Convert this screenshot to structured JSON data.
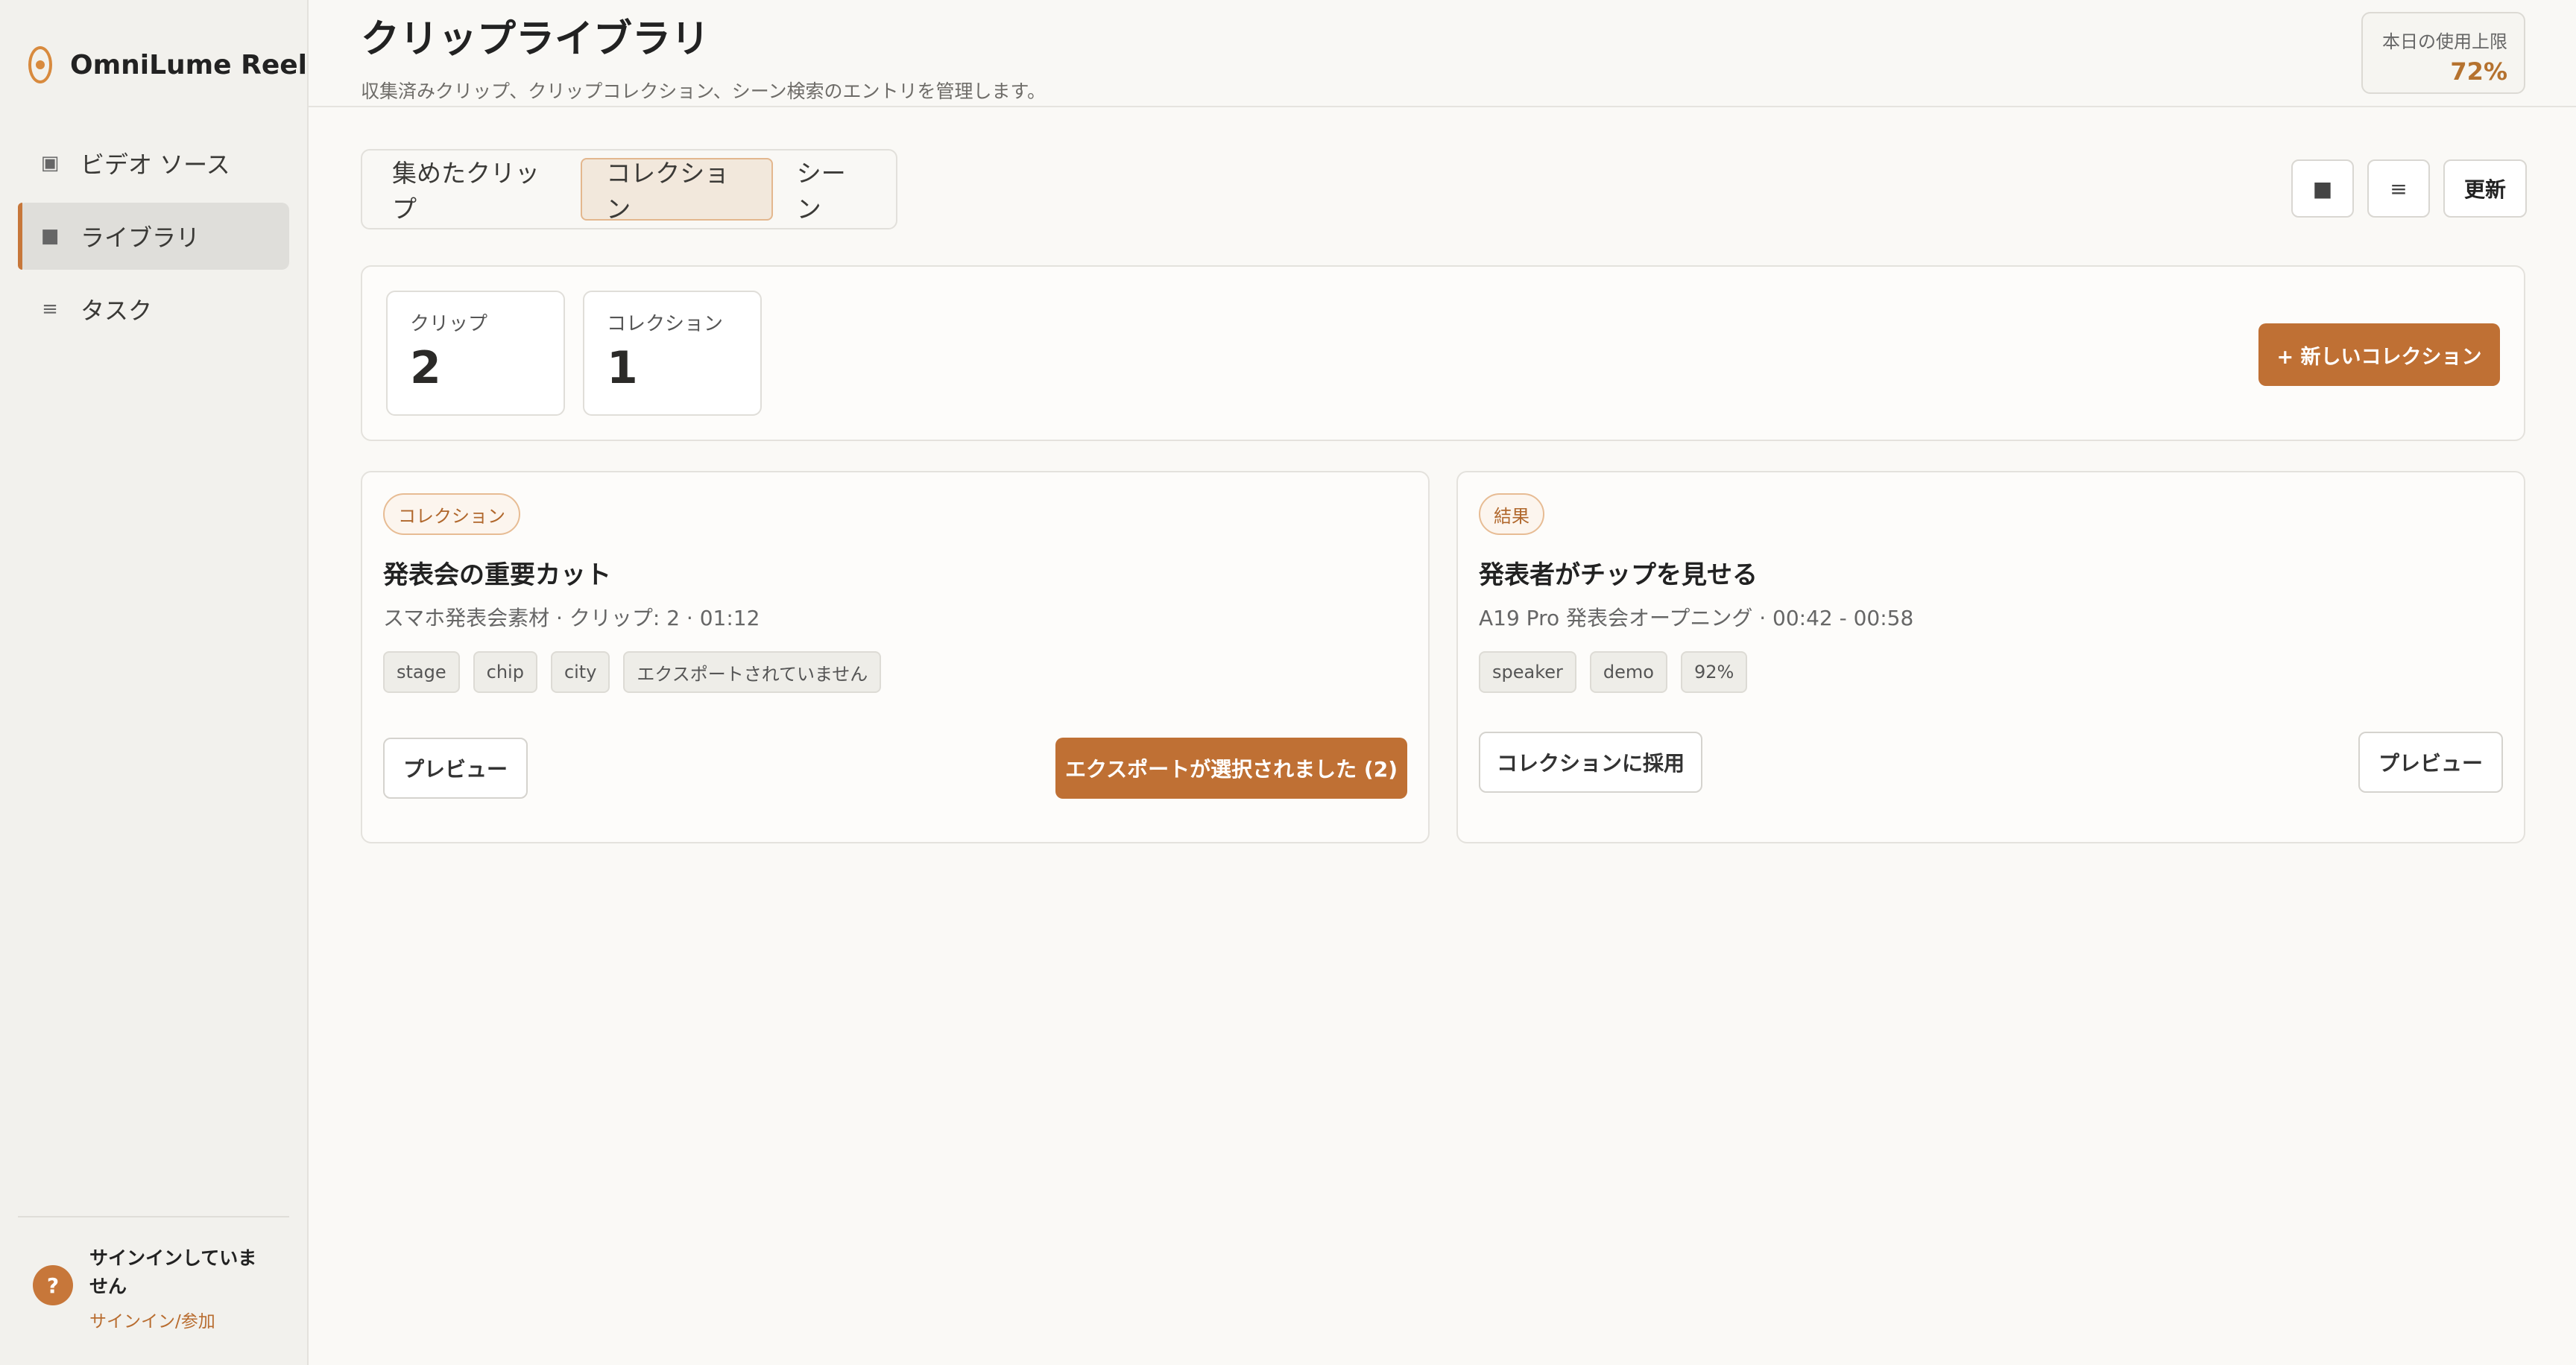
{
  "app": {
    "name": "OmniLume Reel"
  },
  "sidebar": {
    "items": [
      {
        "label": "ビデオ ソース",
        "icon": "▣"
      },
      {
        "label": "ライブラリ",
        "icon": "■"
      },
      {
        "label": "タスク",
        "icon": "≡"
      }
    ],
    "footer": {
      "help_icon": "?",
      "status": "サインインしていません",
      "link": "サインイン/参加"
    }
  },
  "header": {
    "title": "クリップライブラリ",
    "subtitle": "収集済みクリップ、クリップコレクション、シーン検索のエントリを管理します。",
    "usage_label": "本日の使用上限",
    "usage_value": "72%"
  },
  "tabs": [
    {
      "label": "集めたクリップ"
    },
    {
      "label": "コレクション"
    },
    {
      "label": "シーン"
    }
  ],
  "toolbar": {
    "grid_icon": "■",
    "list_icon": "≡",
    "refresh_label": "更新"
  },
  "stats": {
    "clips_label": "クリップ",
    "clips_value": "2",
    "collections_label": "コレクション",
    "collections_value": "1",
    "new_collection_label": "+ 新しいコレクション"
  },
  "cards": [
    {
      "badge": "コレクション",
      "title": "発表会の重要カット",
      "meta": "スマホ発表会素材 · クリップ: 2 · 01:12",
      "tags": [
        "stage",
        "chip",
        "city",
        "エクスポートされていません"
      ],
      "secondary_label": "プレビュー",
      "primary_label": "エクスポートが選択されました (2)"
    },
    {
      "badge": "結果",
      "title": "発表者がチップを見せる",
      "meta": "A19 Pro 発表会オープニング · 00:42 - 00:58",
      "tags": [
        "speaker",
        "demo",
        "92%"
      ],
      "secondary_label": "コレクションに採用",
      "preview_label": "プレビュー"
    }
  ],
  "colors": {
    "accent": "#bf7034",
    "sidebar_bg": "#f2f1ed",
    "page_bg": "#faf9f6"
  }
}
